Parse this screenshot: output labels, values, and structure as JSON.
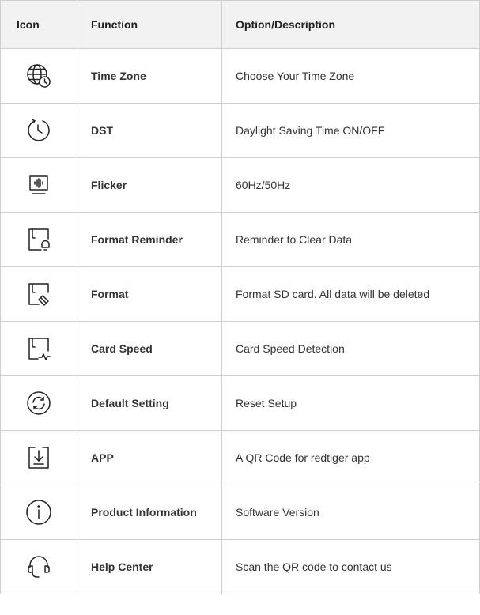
{
  "header": {
    "icon": "Icon",
    "function": "Function",
    "description": "Option/Description"
  },
  "rows": [
    {
      "icon": "globe-clock-icon",
      "function": "Time Zone",
      "description": "Choose Your Time Zone"
    },
    {
      "icon": "clock-arrow-icon",
      "function": "DST",
      "description": "Daylight Saving Time ON/OFF"
    },
    {
      "icon": "monitor-waveform-icon",
      "function": "Flicker",
      "description": "60Hz/50Hz"
    },
    {
      "icon": "sd-card-bell-icon",
      "function": "Format Reminder",
      "description": "Reminder to Clear Data"
    },
    {
      "icon": "sd-card-eraser-icon",
      "function": "Format",
      "description": "Format SD card. All data will be deleted"
    },
    {
      "icon": "sd-card-pulse-icon",
      "function": "Card Speed",
      "description": "Card Speed Detection"
    },
    {
      "icon": "reset-circle-icon",
      "function": "Default Setting",
      "description": "Reset Setup"
    },
    {
      "icon": "download-box-icon",
      "function": "APP",
      "description": "A QR Code for redtiger app"
    },
    {
      "icon": "info-circle-icon",
      "function": "Product Information",
      "description": "Software Version"
    },
    {
      "icon": "headset-icon",
      "function": "Help Center",
      "description": "Scan the QR code to contact us"
    }
  ]
}
